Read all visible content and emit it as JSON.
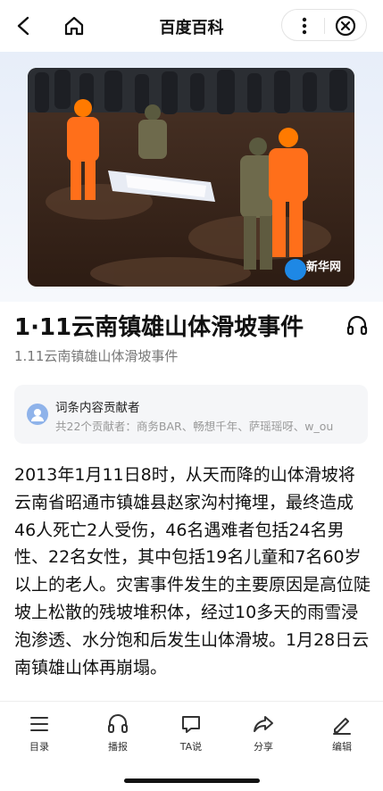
{
  "header": {
    "title": "百度百科",
    "back_icon": "back-arrow-icon",
    "home_icon": "home-icon",
    "more_icon": "more-vertical-icon",
    "close_icon": "close-circle-icon"
  },
  "hero": {
    "image": "photo of rescue workers in orange suits and soldiers carrying a stretcher across muddy landslide ground, crowd in background",
    "watermark": "新华网"
  },
  "article": {
    "title": "1·11云南镇雄山体滑坡事件",
    "subtitle": "1.11云南镇雄山体滑坡事件",
    "listen_icon": "headphones-icon"
  },
  "contributors": {
    "title": "词条内容贡献者",
    "desc": "共22个贡献者：商务BAR、畅想千年、萨瑶瑶呀、w_ou"
  },
  "body": {
    "paragraph": "2013年1月11日8时，从天而降的山体滑坡将云南省昭通市镇雄县赵家沟村掩埋，最终造成46人死亡2人受伤，46名遇难者包括24名男性、22名女性，其中包括19名儿童和7名60岁以上的老人。灾害事件发生的主要原因是高位陡坡上松散的残坡堆积体，经过10多天的雨雪浸泡渗透、水分饱和后发生山体滑坡。1月28日云南镇雄山体再崩塌。"
  },
  "tabbar": {
    "items": [
      {
        "label": "目录",
        "icon": "list-icon"
      },
      {
        "label": "播报",
        "icon": "headphones-icon"
      },
      {
        "label": "TA说",
        "icon": "chat-bubble-icon"
      },
      {
        "label": "分享",
        "icon": "share-icon"
      },
      {
        "label": "编辑",
        "icon": "edit-pencil-icon"
      }
    ]
  },
  "colors": {
    "banner_bg": "#e7eef9",
    "card_bg": "#f5f6f8",
    "text_primary": "#111111",
    "text_secondary": "#777777"
  }
}
